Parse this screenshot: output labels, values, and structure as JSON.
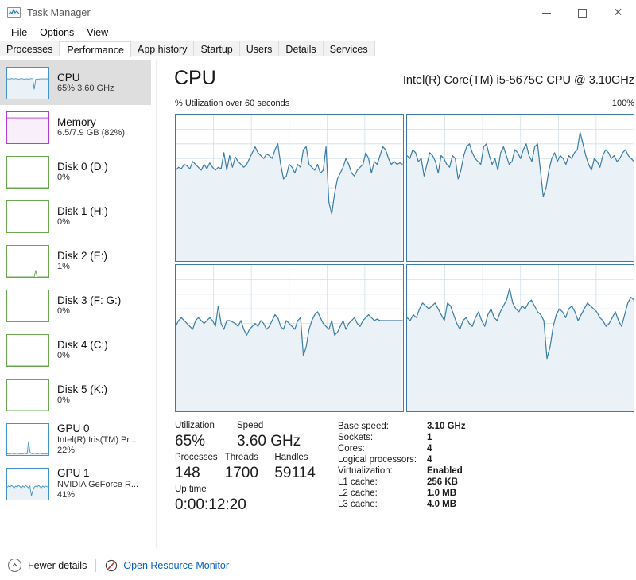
{
  "window": {
    "title": "Task Manager",
    "icon": "task-manager-icon",
    "controls": {
      "minimize": "—",
      "maximize": "□",
      "close": "✕"
    }
  },
  "menu": {
    "items": [
      "File",
      "Options",
      "View"
    ]
  },
  "tabs": {
    "items": [
      "Processes",
      "Performance",
      "App history",
      "Startup",
      "Users",
      "Details",
      "Services"
    ],
    "active": "Performance"
  },
  "sidebar": {
    "items": [
      {
        "title": "CPU",
        "sub": "65%  3.60 GHz",
        "sub2": "",
        "color": "#4394c8",
        "selected": true
      },
      {
        "title": "Memory",
        "sub": "6.5/7.9 GB (82%)",
        "sub2": "",
        "color": "#b43dd0",
        "selected": false
      },
      {
        "title": "Disk 0 (D:)",
        "sub": "0%",
        "sub2": "",
        "color": "#6aa84f",
        "selected": false
      },
      {
        "title": "Disk 1 (H:)",
        "sub": "0%",
        "sub2": "",
        "color": "#6aa84f",
        "selected": false
      },
      {
        "title": "Disk 2 (E:)",
        "sub": "1%",
        "sub2": "",
        "color": "#6aa84f",
        "selected": false
      },
      {
        "title": "Disk 3 (F: G:)",
        "sub": "0%",
        "sub2": "",
        "color": "#6aa84f",
        "selected": false
      },
      {
        "title": "Disk 4 (C:)",
        "sub": "0%",
        "sub2": "",
        "color": "#6aa84f",
        "selected": false
      },
      {
        "title": "Disk 5 (K:)",
        "sub": "0%",
        "sub2": "",
        "color": "#6aa84f",
        "selected": false
      },
      {
        "title": "GPU 0",
        "sub": "Intel(R) Iris(TM) Pr...",
        "sub2": "22%",
        "color": "#4394c8",
        "selected": false
      },
      {
        "title": "GPU 1",
        "sub": "NVIDIA GeForce R...",
        "sub2": "41%",
        "color": "#4394c8",
        "selected": false
      }
    ]
  },
  "main": {
    "title": "CPU",
    "cpu_name": "Intel(R) Core(TM) i5-5675C CPU @ 3.10GHz",
    "graph_caption": "% Utilization over 60 seconds",
    "graph_max": "100%"
  },
  "stats": {
    "left": {
      "row1": [
        {
          "label": "Utilization",
          "value": "65%"
        },
        {
          "label": "Speed",
          "value": "3.60 GHz"
        }
      ],
      "row2": [
        {
          "label": "Processes",
          "value": "148"
        },
        {
          "label": "Threads",
          "value": "1700"
        },
        {
          "label": "Handles",
          "value": "59114"
        }
      ],
      "row3": [
        {
          "label": "Up time",
          "value": "0:00:12:20"
        }
      ]
    },
    "right": [
      {
        "label": "Base speed:",
        "value": "3.10 GHz"
      },
      {
        "label": "Sockets:",
        "value": "1"
      },
      {
        "label": "Cores:",
        "value": "4"
      },
      {
        "label": "Logical processors:",
        "value": "4"
      },
      {
        "label": "Virtualization:",
        "value": "Enabled"
      },
      {
        "label": "L1 cache:",
        "value": "256 KB"
      },
      {
        "label": "L2 cache:",
        "value": "1.0 MB"
      },
      {
        "label": "L3 cache:",
        "value": "4.0 MB"
      }
    ]
  },
  "footer": {
    "fewer_details": "Fewer details",
    "open_resource_monitor": "Open Resource Monitor",
    "chevron": "∧",
    "link_color": "#0b5fbb"
  },
  "chart_data": {
    "type": "area",
    "title": "% Utilization over 60 seconds",
    "xlabel": "60 seconds",
    "ylabel": "% Utilization",
    "ylim": [
      0,
      100
    ],
    "grid": true,
    "legend": "none",
    "line_color": "#3a7ca5",
    "fill_color": "#eaf1f7",
    "panels": [
      {
        "name": "Logical processor 0",
        "values": [
          62,
          64,
          63,
          66,
          65,
          63,
          68,
          66,
          64,
          62,
          66,
          63,
          67,
          64,
          62,
          64,
          63,
          74,
          62,
          72,
          64,
          71,
          68,
          66,
          64,
          66,
          70,
          74,
          78,
          74,
          72,
          70,
          73,
          72,
          70,
          76,
          80,
          66,
          56,
          58,
          66,
          64,
          60,
          66,
          64,
          76,
          78,
          66,
          64,
          62,
          66,
          60,
          62,
          78,
          40,
          32,
          46,
          56,
          60,
          64,
          70,
          66,
          60,
          58,
          62,
          64,
          66,
          74,
          70,
          60,
          68,
          66,
          72,
          78,
          76,
          70,
          66,
          68,
          66,
          67,
          66
        ]
      },
      {
        "name": "Logical processor 1",
        "values": [
          72,
          70,
          76,
          74,
          68,
          70,
          58,
          66,
          74,
          72,
          68,
          60,
          72,
          70,
          66,
          64,
          72,
          70,
          56,
          62,
          72,
          78,
          80,
          74,
          70,
          68,
          66,
          78,
          80,
          72,
          66,
          70,
          62,
          74,
          78,
          72,
          66,
          68,
          76,
          74,
          70,
          76,
          80,
          72,
          68,
          78,
          80,
          62,
          44,
          50,
          62,
          70,
          74,
          68,
          72,
          70,
          66,
          72,
          70,
          74,
          76,
          88,
          80,
          72,
          66,
          62,
          70,
          68,
          64,
          72,
          76,
          74,
          70,
          72,
          68,
          70,
          74,
          76,
          72,
          70,
          68
        ]
      },
      {
        "name": "Logical processor 2",
        "values": [
          58,
          62,
          64,
          62,
          60,
          58,
          56,
          62,
          64,
          62,
          60,
          62,
          64,
          62,
          58,
          72,
          60,
          56,
          62,
          62,
          61,
          60,
          58,
          62,
          56,
          52,
          56,
          58,
          60,
          58,
          62,
          60,
          56,
          58,
          62,
          66,
          64,
          58,
          56,
          62,
          60,
          58,
          56,
          62,
          64,
          38,
          44,
          56,
          62,
          66,
          68,
          64,
          60,
          58,
          56,
          62,
          52,
          54,
          58,
          62,
          56,
          60,
          62,
          64,
          60,
          58,
          62,
          64,
          66,
          64,
          62,
          63,
          62,
          62,
          62,
          62,
          62,
          62,
          62,
          62,
          62
        ]
      },
      {
        "name": "Logical processor 3",
        "values": [
          64,
          62,
          66,
          64,
          70,
          74,
          72,
          70,
          72,
          74,
          70,
          66,
          62,
          74,
          72,
          66,
          60,
          56,
          62,
          64,
          60,
          58,
          64,
          68,
          62,
          58,
          66,
          70,
          64,
          62,
          68,
          72,
          76,
          84,
          74,
          70,
          68,
          72,
          70,
          74,
          76,
          72,
          68,
          66,
          62,
          36,
          44,
          58,
          66,
          70,
          68,
          64,
          70,
          72,
          68,
          62,
          66,
          70,
          74,
          72,
          70,
          68,
          64,
          62,
          58,
          60,
          64,
          68,
          62,
          58,
          66,
          74,
          78,
          76
        ]
      }
    ],
    "sidebar_thumbnails": [
      {
        "name": "CPU",
        "values": [
          64,
          64,
          63,
          65,
          64,
          64,
          65,
          64,
          63,
          64,
          65,
          64,
          63,
          64,
          64,
          63,
          64,
          65,
          64,
          30,
          62,
          64,
          63,
          64,
          64,
          64,
          64,
          64,
          64,
          64
        ]
      },
      {
        "name": "Memory",
        "values": [
          82,
          82,
          82,
          82,
          82,
          82,
          82,
          82,
          82,
          82,
          82,
          82,
          82,
          82,
          82,
          82,
          82,
          82,
          82,
          82,
          82,
          82,
          82,
          82,
          82,
          82,
          82,
          82,
          82,
          82
        ]
      },
      {
        "name": "Disk 0",
        "values": [
          0,
          0,
          0,
          0,
          0,
          0,
          0,
          0,
          0,
          0,
          0,
          0,
          0,
          0,
          0,
          0,
          0,
          0,
          0,
          0,
          0,
          0,
          0,
          0,
          0,
          0,
          0,
          0,
          0,
          0
        ]
      },
      {
        "name": "Disk 1",
        "values": [
          0,
          0,
          0,
          0,
          0,
          0,
          0,
          0,
          0,
          0,
          0,
          0,
          0,
          0,
          0,
          0,
          0,
          0,
          0,
          0,
          0,
          0,
          0,
          0,
          0,
          0,
          0,
          0,
          0,
          0
        ]
      },
      {
        "name": "Disk 2",
        "values": [
          0,
          0,
          0,
          0,
          0,
          0,
          0,
          0,
          0,
          0,
          0,
          0,
          0,
          0,
          0,
          0,
          0,
          0,
          0,
          0,
          22,
          0,
          0,
          0,
          0,
          0,
          0,
          0,
          0,
          0
        ]
      },
      {
        "name": "Disk 3",
        "values": [
          0,
          0,
          0,
          0,
          0,
          0,
          0,
          0,
          0,
          0,
          0,
          0,
          0,
          0,
          0,
          0,
          0,
          0,
          0,
          0,
          0,
          0,
          0,
          0,
          0,
          0,
          0,
          0,
          0,
          0
        ]
      },
      {
        "name": "Disk 4",
        "values": [
          0,
          0,
          0,
          0,
          0,
          0,
          0,
          0,
          0,
          0,
          0,
          0,
          0,
          0,
          0,
          0,
          0,
          0,
          0,
          0,
          0,
          0,
          0,
          0,
          0,
          0,
          0,
          0,
          0,
          0
        ]
      },
      {
        "name": "Disk 5",
        "values": [
          0,
          0,
          0,
          0,
          0,
          0,
          0,
          0,
          0,
          0,
          0,
          0,
          0,
          0,
          0,
          0,
          0,
          0,
          0,
          0,
          0,
          0,
          0,
          0,
          0,
          0,
          0,
          0,
          0,
          0
        ]
      },
      {
        "name": "GPU 0",
        "values": [
          4,
          5,
          4,
          6,
          5,
          4,
          5,
          6,
          5,
          4,
          5,
          4,
          6,
          5,
          4,
          44,
          10,
          5,
          4,
          6,
          5,
          4,
          5,
          6,
          5,
          4,
          5,
          4,
          5,
          4
        ]
      },
      {
        "name": "GPU 1",
        "values": [
          40,
          44,
          40,
          46,
          42,
          38,
          44,
          40,
          46,
          42,
          38,
          44,
          40,
          46,
          42,
          38,
          44,
          12,
          30,
          40,
          44,
          40,
          46,
          42,
          38,
          44,
          40,
          44,
          42,
          40
        ]
      }
    ]
  }
}
